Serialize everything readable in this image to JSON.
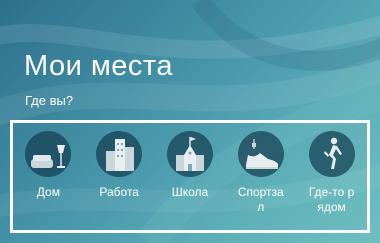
{
  "header": {
    "title": "Мои места",
    "subtitle": "Где вы?"
  },
  "places": [
    {
      "label": "Дом",
      "icon": "home-lamp-icon"
    },
    {
      "label": "Работа",
      "icon": "office-buildings-icon"
    },
    {
      "label": "Школа",
      "icon": "school-building-icon"
    },
    {
      "label": "Спортзал",
      "icon": "sneaker-icon"
    },
    {
      "label": "Где-то рядом",
      "icon": "walking-person-icon"
    }
  ],
  "colors": {
    "background_start": "#2e6f8c",
    "background_end": "#6fbfc0",
    "text": "#ffffff",
    "frame": "#ffffff"
  }
}
